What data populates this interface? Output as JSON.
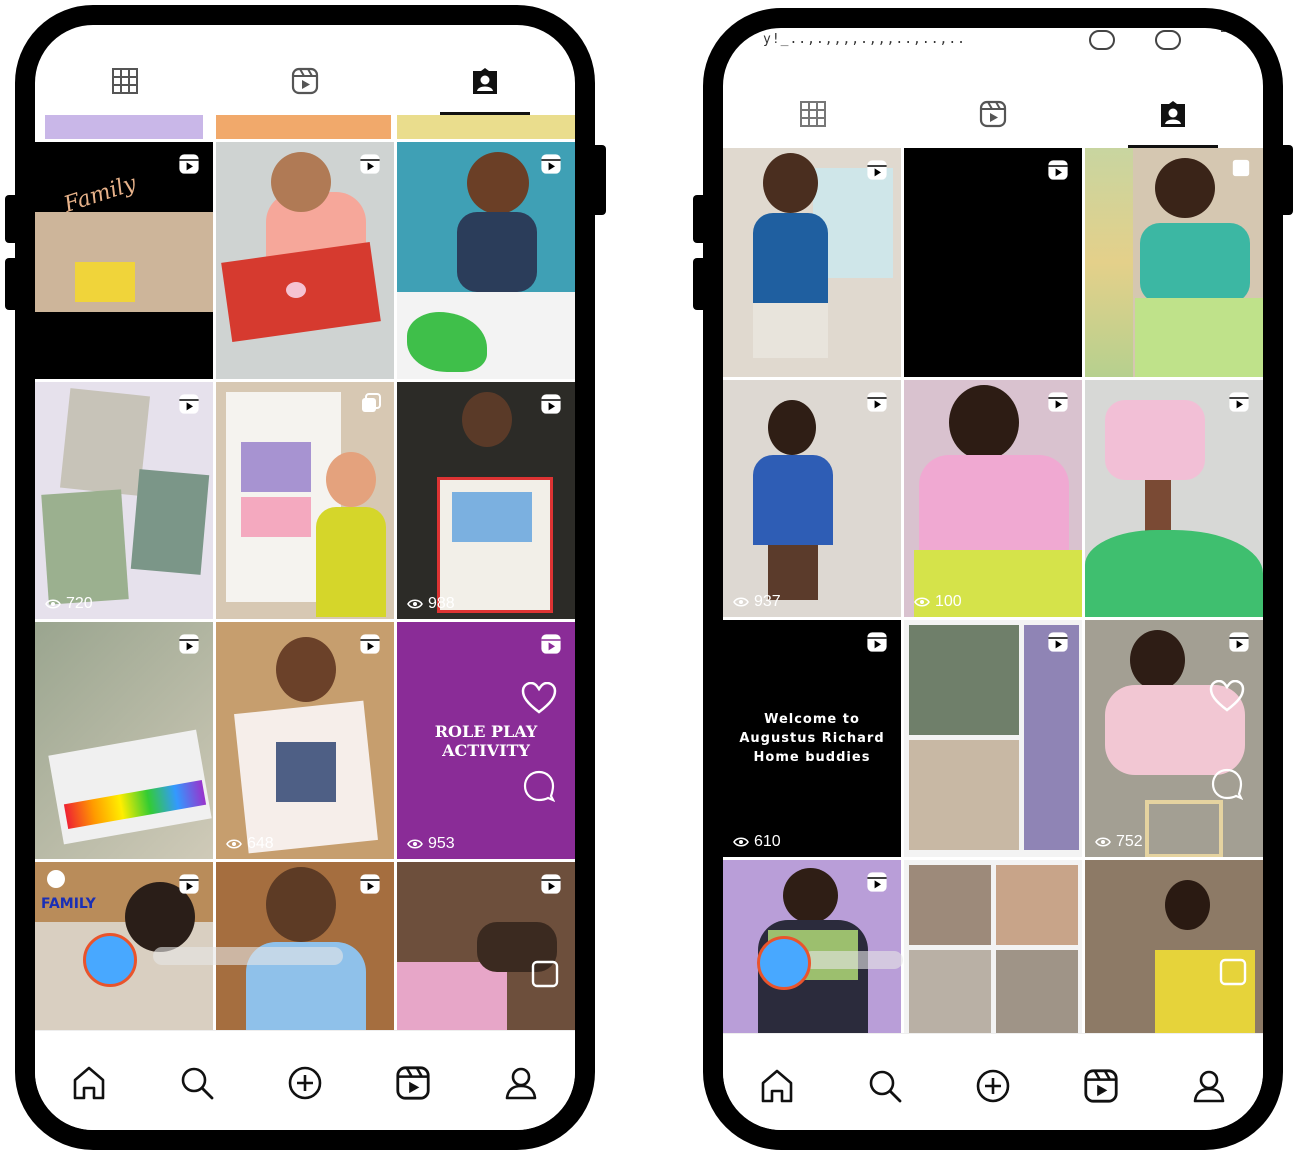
{
  "left_phone": {
    "tab_icons": [
      "grid-icon",
      "reels-icon",
      "tagged-icon"
    ],
    "tiles": [
      {
        "name": "tile-family-video",
        "views": "",
        "text": "Family",
        "reel": true
      },
      {
        "name": "tile-dont-forget-card",
        "views": "",
        "text": "",
        "reel": true
      },
      {
        "name": "tile-painting-boy",
        "views": "",
        "text": "",
        "reel": true
      },
      {
        "name": "tile-photo-collage",
        "views": "720",
        "text": "",
        "reel": true
      },
      {
        "name": "tile-house-drawing",
        "views": "",
        "text": "",
        "reel": false
      },
      {
        "name": "tile-my-home-poster",
        "views": "988",
        "text": "",
        "reel": true
      },
      {
        "name": "tile-crayons",
        "views": "",
        "text": "",
        "reel": true
      },
      {
        "name": "tile-family-photo-frame",
        "views": "648",
        "text": "",
        "reel": true
      },
      {
        "name": "tile-role-play-activity",
        "views": "953",
        "text": "ROLE PLAY\nACTIVITY",
        "reel": true
      },
      {
        "name": "tile-family-craft",
        "views": "",
        "text": "FAMILY",
        "reel": true
      },
      {
        "name": "tile-boy-activity",
        "views": "",
        "text": "",
        "reel": true
      },
      {
        "name": "tile-hands-craft",
        "views": "",
        "text": "",
        "reel": true
      }
    ],
    "nav_icons": [
      "home-icon",
      "search-icon",
      "create-icon",
      "reels-icon",
      "profile-icon"
    ]
  },
  "right_phone": {
    "status_text": "y!_..,.,,,,.,,,..,..,..",
    "tab_icons": [
      "grid-icon",
      "reels-icon",
      "tagged-icon"
    ],
    "tiles": [
      {
        "name": "tile-sup-boy",
        "views": "",
        "text": "",
        "reel": true
      },
      {
        "name": "tile-black",
        "views": "",
        "text": "",
        "reel": true
      },
      {
        "name": "tile-girl-collage",
        "views": "",
        "text": "",
        "reel": false
      },
      {
        "name": "tile-boy-blue-sweater",
        "views": "937",
        "text": "",
        "reel": true
      },
      {
        "name": "tile-girl-pink",
        "views": "100",
        "text": "",
        "reel": true
      },
      {
        "name": "tile-tree-craft",
        "views": "",
        "text": "",
        "reel": true
      },
      {
        "name": "tile-welcome",
        "views": "610",
        "text": "Welcome to\nAugustus Richard\nHome buddies",
        "reel": true
      },
      {
        "name": "tile-kids-collage",
        "views": "",
        "text": "",
        "reel": true
      },
      {
        "name": "tile-girl-floor",
        "views": "752",
        "text": "",
        "reel": true
      },
      {
        "name": "tile-girl-purple",
        "views": "",
        "text": "",
        "reel": true
      },
      {
        "name": "tile-kids-frames",
        "views": "",
        "text": "",
        "reel": false
      },
      {
        "name": "tile-girl-yellow-card",
        "views": "",
        "text": "",
        "reel": false
      }
    ],
    "nav_icons": [
      "home-icon",
      "search-icon",
      "create-icon",
      "reels-icon",
      "profile-icon"
    ]
  },
  "colors": {
    "frame": "#000000",
    "fab": "#48a8ff",
    "fab_border": "#e9542c",
    "role_play_bg": "#8a2c97"
  }
}
